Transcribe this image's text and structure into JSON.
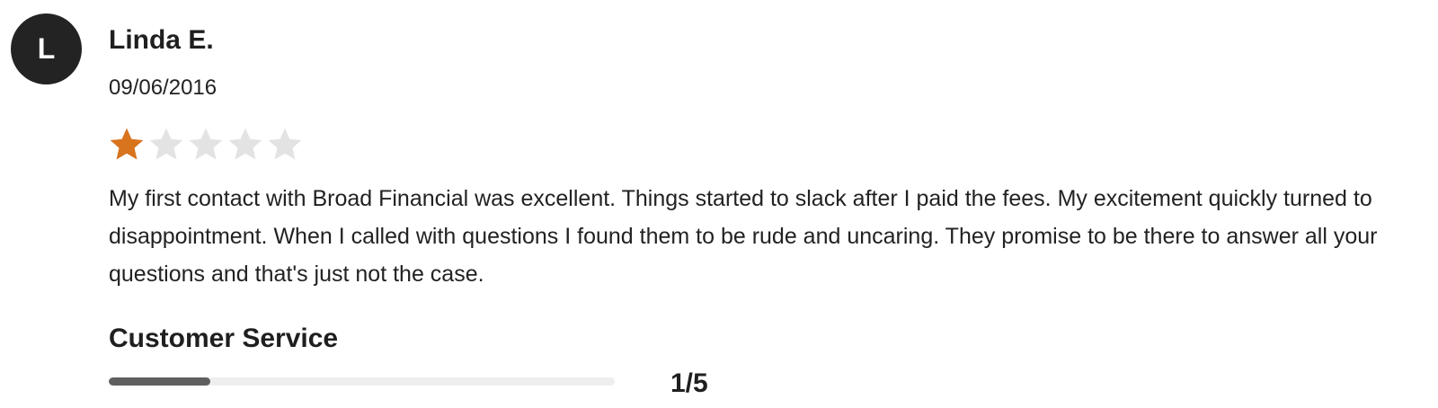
{
  "review": {
    "avatar_initial": "L",
    "reviewer_name": "Linda E.",
    "date": "09/06/2016",
    "rating": {
      "value": 1,
      "max": 5
    },
    "text": "My first contact with Broad Financial was excellent. Things started to slack after I paid the fees. My excitement quickly turned to disappointment. When I called with questions I found them to be rude and uncaring. They promise to be there to answer all your questions and that's just not the case.",
    "categories": [
      {
        "title": "Customer Service",
        "score_text": "1/5",
        "score": 1,
        "max": 5
      }
    ]
  },
  "colors": {
    "avatar_bg": "#232323",
    "star_filled": "#d8731e",
    "star_empty": "#e3e3e3",
    "bar_fill": "#5f5f5f",
    "bar_track": "#eeeeee"
  },
  "icons": {
    "rating_star": "star-icon"
  }
}
